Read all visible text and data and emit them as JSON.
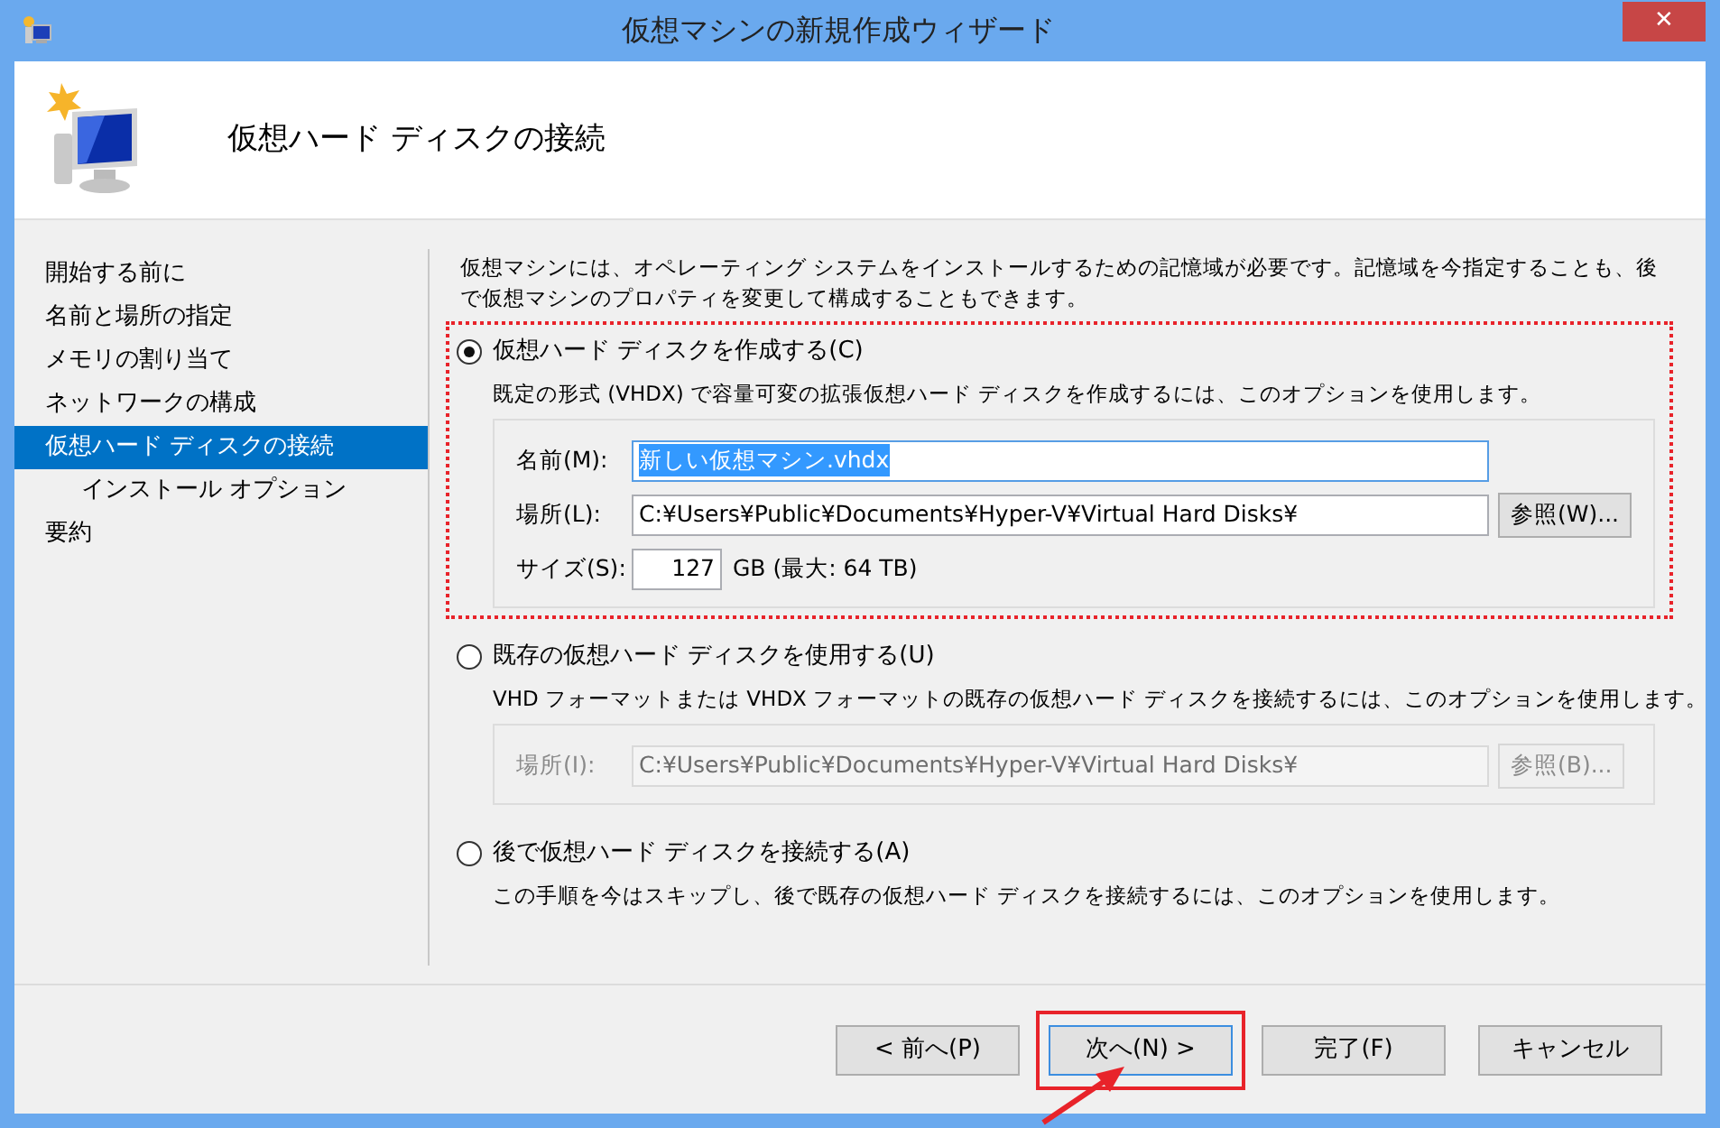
{
  "window": {
    "title": "仮想マシンの新規作成ウィザード",
    "close": "✕"
  },
  "header": {
    "title": "仮想ハード ディスクの接続"
  },
  "sidebar": {
    "items": [
      {
        "label": "開始する前に",
        "selected": false
      },
      {
        "label": "名前と場所の指定",
        "selected": false
      },
      {
        "label": "メモリの割り当て",
        "selected": false
      },
      {
        "label": "ネットワークの構成",
        "selected": false
      },
      {
        "label": "仮想ハード ディスクの接続",
        "selected": true,
        "children": [
          {
            "label": "インストール オプション",
            "selected": false
          }
        ]
      },
      {
        "label": "要約",
        "selected": false
      }
    ]
  },
  "intro": "仮想マシンには、オペレーティング システムをインストールするための記憶域が必要です。記憶域を今指定することも、後で仮想マシンのプロパティを変更して構成することもできます。",
  "options": [
    {
      "label": "仮想ハード ディスクを作成する(C)",
      "selected": true,
      "highlighted": true,
      "description": "既定の形式 (VHDX) で容量可変の拡張仮想ハード ディスクを作成するには、このオプションを使用します。",
      "fields_disabled": false,
      "fields": [
        {
          "kind": "name",
          "label": "名前(M):",
          "value": "新しい仮想マシン.vhdx",
          "text_selected": true
        },
        {
          "kind": "path",
          "label": "場所(L):",
          "value": "C:¥Users¥Public¥Documents¥Hyper-V¥Virtual Hard Disks¥",
          "button": "参照(W)..."
        },
        {
          "kind": "size",
          "label": "サイズ(S):",
          "value": "127",
          "suffix": "GB (最大: 64 TB)"
        }
      ]
    },
    {
      "label": "既存の仮想ハード ディスクを使用する(U)",
      "selected": false,
      "highlighted": false,
      "description": "VHD フォーマットまたは VHDX フォーマットの既存の仮想ハード ディスクを接続するには、このオプションを使用します。",
      "fields_disabled": true,
      "fields": [
        {
          "kind": "path",
          "label": "場所(I):",
          "value": "C:¥Users¥Public¥Documents¥Hyper-V¥Virtual Hard Disks¥",
          "button": "参照(B)..."
        }
      ]
    },
    {
      "label": "後で仮想ハード ディスクを接続する(A)",
      "selected": false,
      "highlighted": false,
      "description": "この手順を今はスキップし、後で既存の仮想ハード ディスクを接続するには、このオプションを使用します。"
    }
  ],
  "buttons": [
    {
      "label": "< 前へ(P)",
      "focused": false,
      "highlighted": false
    },
    {
      "label": "次へ(N) >",
      "focused": true,
      "highlighted": true
    },
    {
      "label": "完了(F)",
      "focused": false,
      "highlighted": false
    },
    {
      "label": "キャンセル",
      "focused": false,
      "highlighted": false
    }
  ]
}
